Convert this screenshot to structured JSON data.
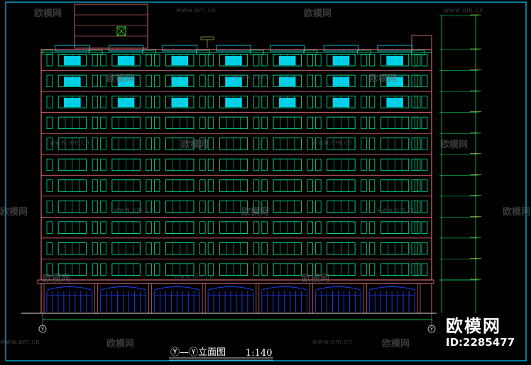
{
  "drawing": {
    "title": "Ⓨ—Ⓨ立面图",
    "scale": "1:140",
    "axis_left": "Y",
    "axis_right": "Y",
    "floors": 11,
    "bays": 7
  },
  "watermarks": {
    "url": "www.om.cn",
    "logo": "欧模网"
  },
  "brand": {
    "name": "欧模网",
    "id": "ID:2285477"
  },
  "colors": {
    "background": "#000000",
    "frame": "#00c8ff",
    "facade_line": "#ff8080",
    "window": "#00ffaa",
    "balcony_glass": "#00e5ff",
    "shop_blue": "#2040ff",
    "dimension": "#00ff66",
    "note_yellow": "#ffff66"
  }
}
